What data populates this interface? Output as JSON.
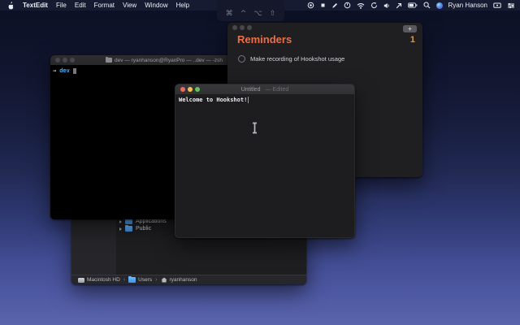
{
  "menu_bar": {
    "app_name": "TextEdit",
    "menus": [
      "File",
      "Edit",
      "Format",
      "View",
      "Window",
      "Help"
    ],
    "user_name": "Ryan Hanson"
  },
  "modifier_panel": {
    "keys": [
      "⌘",
      "^",
      "⌥",
      "⇧"
    ]
  },
  "reminders_window": {
    "title": "Reminders",
    "count": "1",
    "add_button_label": "+",
    "item": {
      "label": "Make recording of Hookshot usage"
    },
    "accent_title_color": "#ed6e45",
    "accent_count_color": "#e0953e"
  },
  "terminal_window": {
    "title": "dev — ryanhanson@RyanPro — ..dev — -zsh",
    "prompt_symbol": "→",
    "prompt_path": "dev"
  },
  "textedit_window": {
    "title": "Untitled",
    "edited_suffix": "— Edited",
    "content": "Welcome to Hookshot!"
  },
  "finder_window": {
    "rows": [
      {
        "label": "Applications"
      },
      {
        "label": "Public"
      }
    ],
    "path": [
      {
        "label": "Macintosh HD"
      },
      {
        "label": "Users"
      },
      {
        "label": "ryanhanson"
      }
    ]
  }
}
